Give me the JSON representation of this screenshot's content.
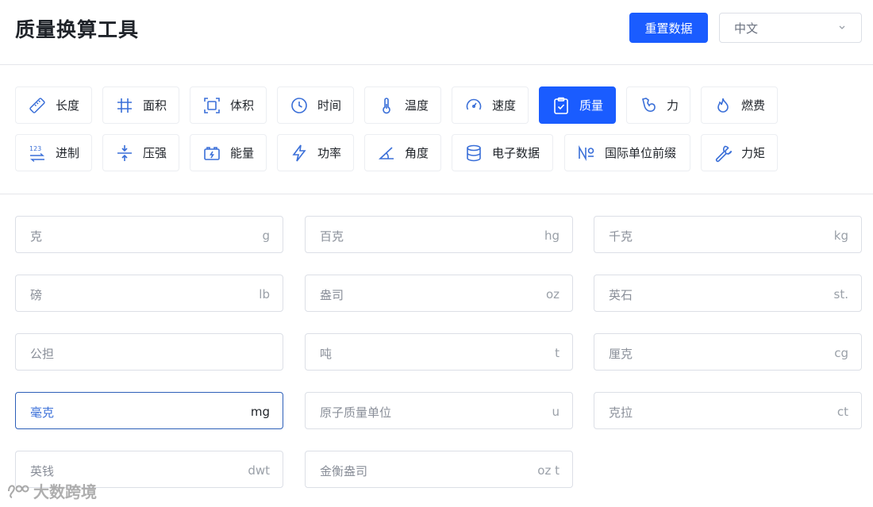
{
  "header": {
    "title": "质量换算工具",
    "reset_label": "重置数据",
    "language": "中文"
  },
  "categories": [
    {
      "label": "长度",
      "icon": "ruler-icon"
    },
    {
      "label": "面积",
      "icon": "hash-icon"
    },
    {
      "label": "体积",
      "icon": "frame-icon"
    },
    {
      "label": "时间",
      "icon": "clock-icon"
    },
    {
      "label": "温度",
      "icon": "thermometer-icon"
    },
    {
      "label": "速度",
      "icon": "speedometer-icon"
    },
    {
      "label": "质量",
      "icon": "clipboard-icon",
      "active": true
    },
    {
      "label": "力",
      "icon": "muscle-icon"
    },
    {
      "label": "燃费",
      "icon": "flame-icon"
    },
    {
      "label": "进制",
      "icon": "number-base-icon"
    },
    {
      "label": "压强",
      "icon": "compress-icon"
    },
    {
      "label": "能量",
      "icon": "battery-icon"
    },
    {
      "label": "功率",
      "icon": "lightning-icon"
    },
    {
      "label": "角度",
      "icon": "angle-icon"
    },
    {
      "label": "电子数据",
      "icon": "database-icon"
    },
    {
      "label": "国际单位前缀",
      "icon": "numero-icon"
    },
    {
      "label": "力矩",
      "icon": "wrench-icon"
    }
  ],
  "units": [
    {
      "name": "克",
      "unit": "g"
    },
    {
      "name": "百克",
      "unit": "hg"
    },
    {
      "name": "千克",
      "unit": "kg"
    },
    {
      "name": "磅",
      "unit": "lb"
    },
    {
      "name": "盎司",
      "unit": "oz"
    },
    {
      "name": "英石",
      "unit": "st."
    },
    {
      "name": "公担",
      "unit": ""
    },
    {
      "name": "吨",
      "unit": "t"
    },
    {
      "name": "厘克",
      "unit": "cg"
    },
    {
      "name": "毫克",
      "unit": "mg",
      "focused": true
    },
    {
      "name": "原子质量单位",
      "unit": "u"
    },
    {
      "name": "克拉",
      "unit": "ct"
    },
    {
      "name": "英钱",
      "unit": "dwt"
    },
    {
      "name": "金衡盎司",
      "unit": "oz t"
    }
  ],
  "watermark": "大数跨境",
  "colors": {
    "accent": "#1a5cff",
    "icon": "#3a6fd8",
    "focus_border": "#2d5fb8"
  }
}
